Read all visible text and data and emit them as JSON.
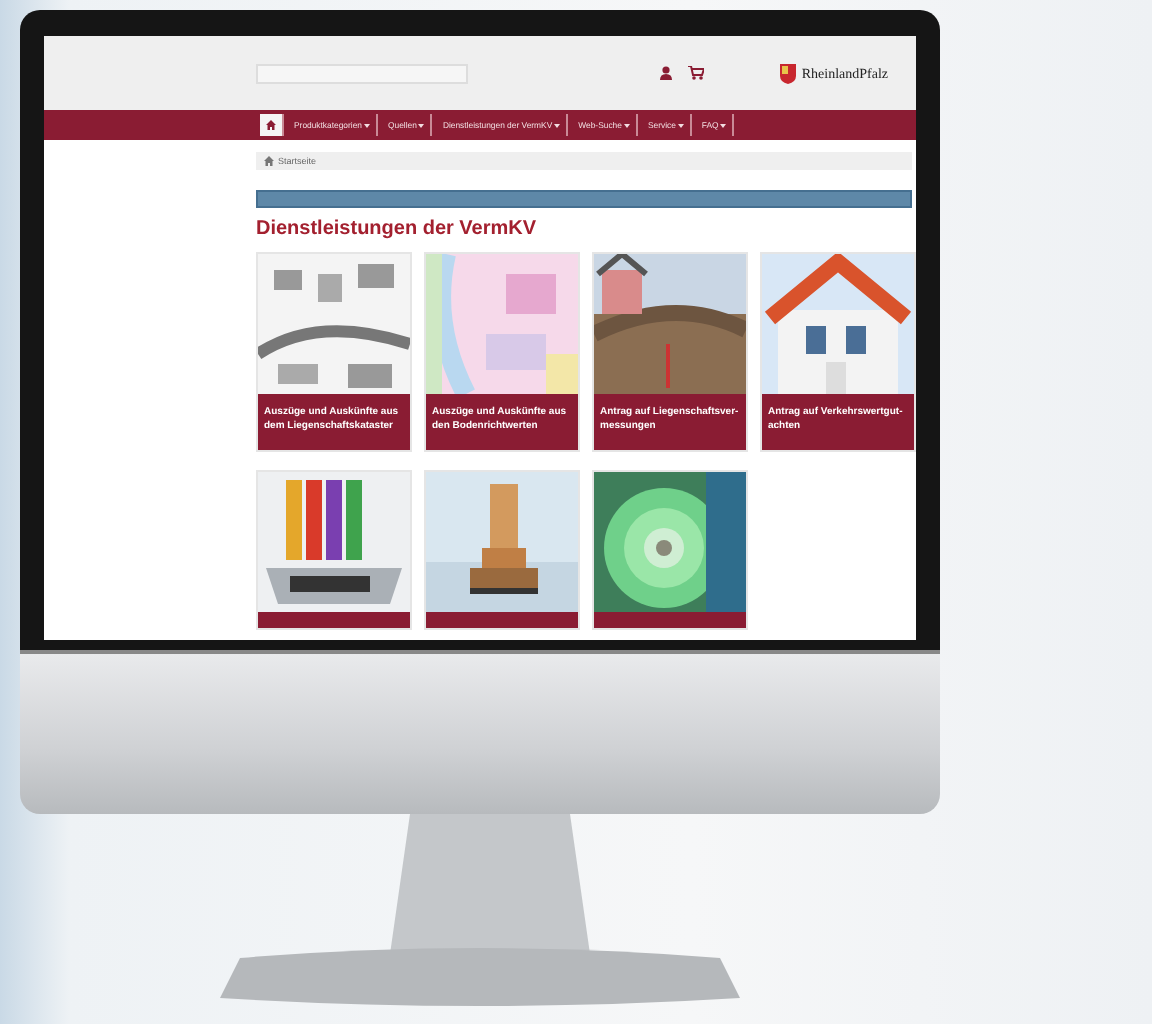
{
  "header": {
    "logo": "RheinlandPfalz"
  },
  "nav": {
    "items": [
      {
        "kind": "home",
        "selected": true
      },
      {
        "kind": "menu",
        "label": "Produktkategorien",
        "selected": false
      },
      {
        "kind": "menu",
        "label": "Quellen",
        "selected": false
      },
      {
        "kind": "menu",
        "label": "Dienstleistungen der VermKV",
        "selected": false
      },
      {
        "kind": "menu",
        "label": "Web-Suche",
        "selected": false
      },
      {
        "kind": "menu",
        "label": "Service",
        "selected": false
      },
      {
        "kind": "menu",
        "label": "FAQ",
        "selected": false
      }
    ]
  },
  "breadcrumb": "Startseite",
  "heading": "Dienstleistungen der VermKV",
  "cards": [
    {
      "kind": "full",
      "title": "Auszüge und Auskünfte aus dem Liegenschaftskataster"
    },
    {
      "kind": "full",
      "title": "Auszüge und Auskünfte aus den Bodenrichtwerten"
    },
    {
      "kind": "full",
      "title": "Antrag auf Liegenschaftsver-messungen"
    },
    {
      "kind": "full",
      "title": "Antrag auf Verkehrswertgut-achten"
    },
    {
      "kind": "cut"
    },
    {
      "kind": "cut"
    },
    {
      "kind": "cut"
    }
  ]
}
